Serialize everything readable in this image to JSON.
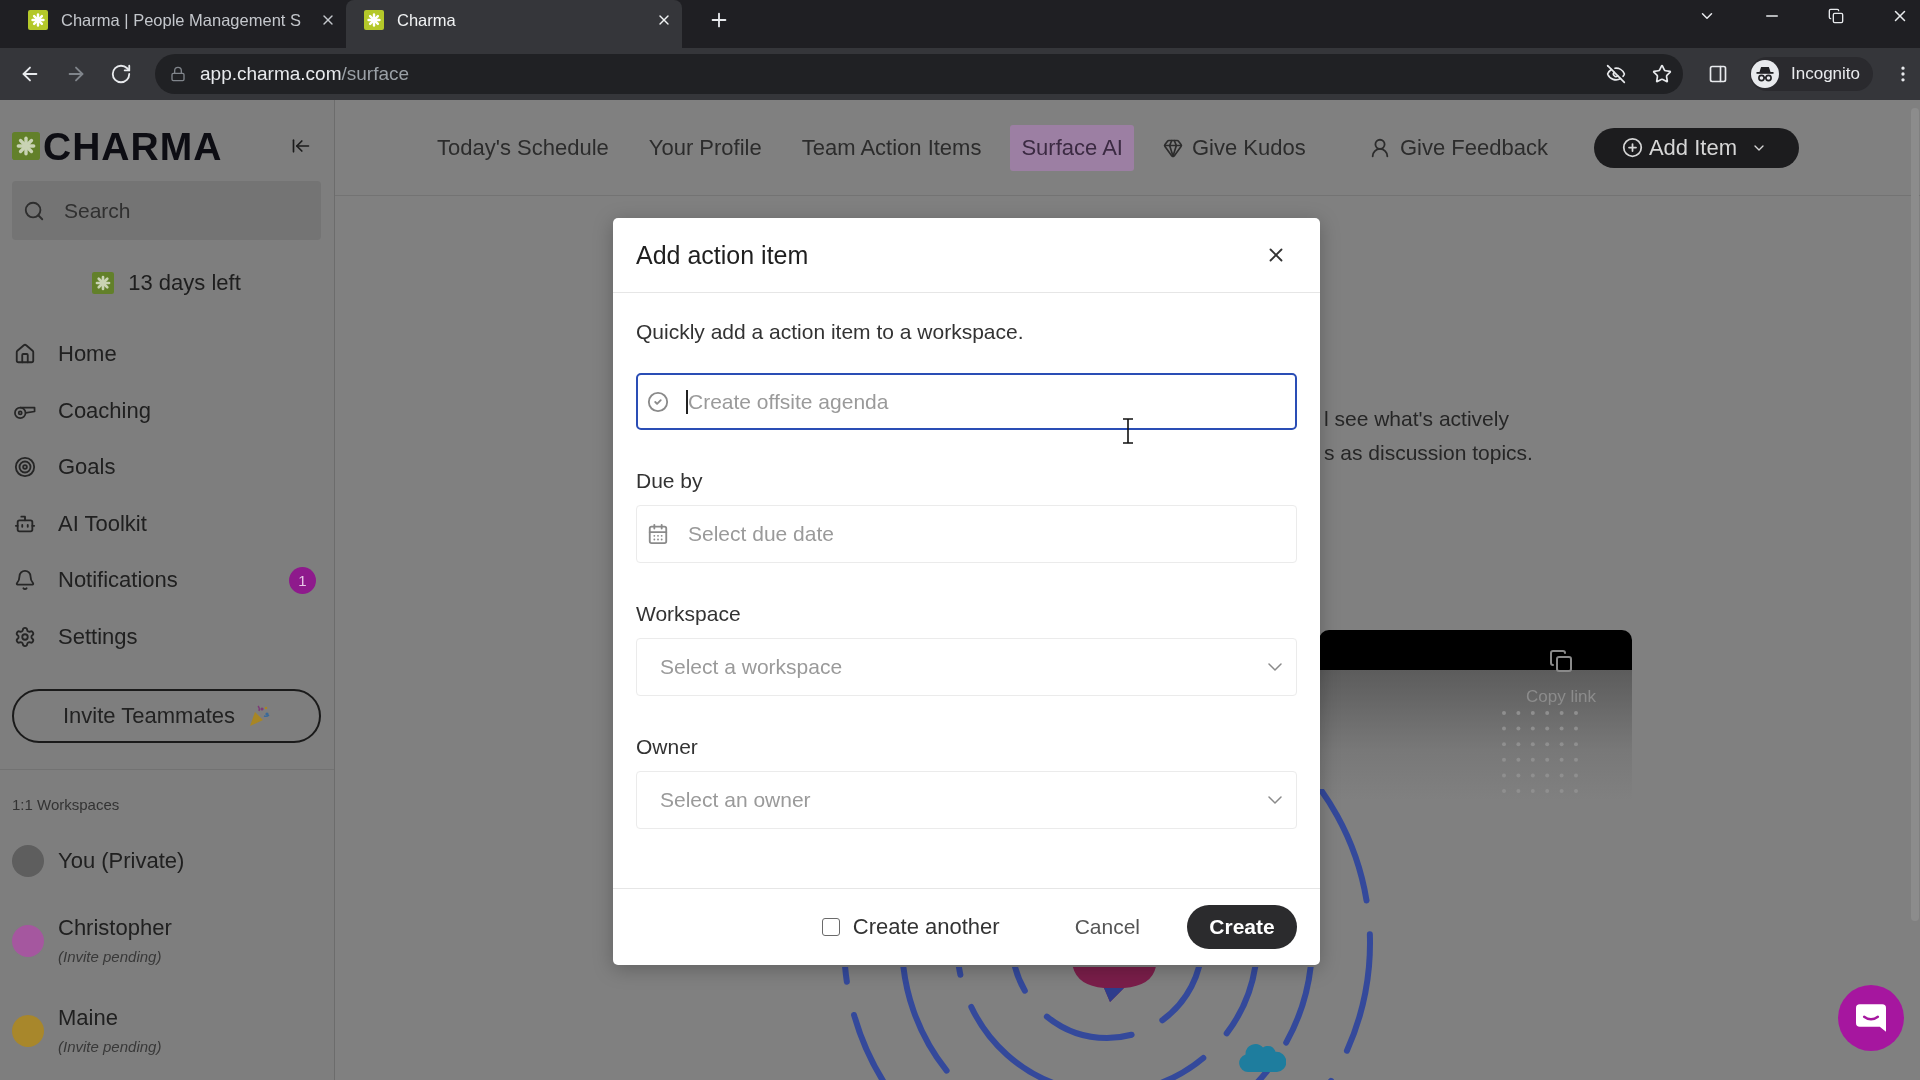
{
  "browser": {
    "tabs": [
      {
        "title": "Charma | People Management S",
        "selected": false
      },
      {
        "title": "Charma",
        "selected": true
      }
    ],
    "url_host": "app.charma.com",
    "url_path": "/surface",
    "profile": "Incognito"
  },
  "sidebar": {
    "logo": "CHARMA",
    "search": {
      "placeholder": "Search"
    },
    "trial": "13 days left",
    "nav": [
      {
        "label": "Home",
        "selected": false
      },
      {
        "label": "Coaching",
        "selected": false
      },
      {
        "label": "Goals",
        "selected": false
      },
      {
        "label": "AI Toolkit",
        "selected": false
      },
      {
        "label": "Notifications",
        "selected": false,
        "badge": "1"
      },
      {
        "label": "Settings",
        "selected": false
      }
    ],
    "invite_button": "Invite Teammates",
    "workspaces_heading": "1:1 Workspaces",
    "workspaces": [
      {
        "name": "You (Private)",
        "color": "#5e5e5e"
      },
      {
        "name": "Christopher",
        "note": "(Invite pending)",
        "color": "#a5579f"
      },
      {
        "name": "Maine",
        "note": "(Invite pending)",
        "color": "#a8872b"
      }
    ]
  },
  "top_nav": {
    "links": [
      {
        "label": "Today's Schedule",
        "selected": false
      },
      {
        "label": "Your Profile",
        "selected": false
      },
      {
        "label": "Team Action Items",
        "selected": false
      },
      {
        "label": "Surface AI",
        "selected": true
      },
      {
        "label": "Give Kudos",
        "selected": false
      },
      {
        "label": "Give Feedback",
        "selected": false
      }
    ],
    "add_button": "Add Item"
  },
  "background": {
    "text_lines": [
      "l see what's actively",
      "s as discussion topics."
    ],
    "card_action": "Copy link"
  },
  "modal": {
    "title": "Add action item",
    "description": "Quickly add a action item to a workspace.",
    "title_field": {
      "placeholder": "Create offsite agenda",
      "focused": true
    },
    "fields": [
      {
        "label": "Due by",
        "kind": "date",
        "placeholder": "Select due date"
      },
      {
        "label": "Workspace",
        "kind": "select",
        "placeholder": "Select a workspace"
      },
      {
        "label": "Owner",
        "kind": "select",
        "placeholder": "Select an owner"
      }
    ],
    "create_another": {
      "label": "Create another",
      "checked": false
    },
    "buttons": {
      "cancel": "Cancel",
      "create": "Create"
    }
  }
}
